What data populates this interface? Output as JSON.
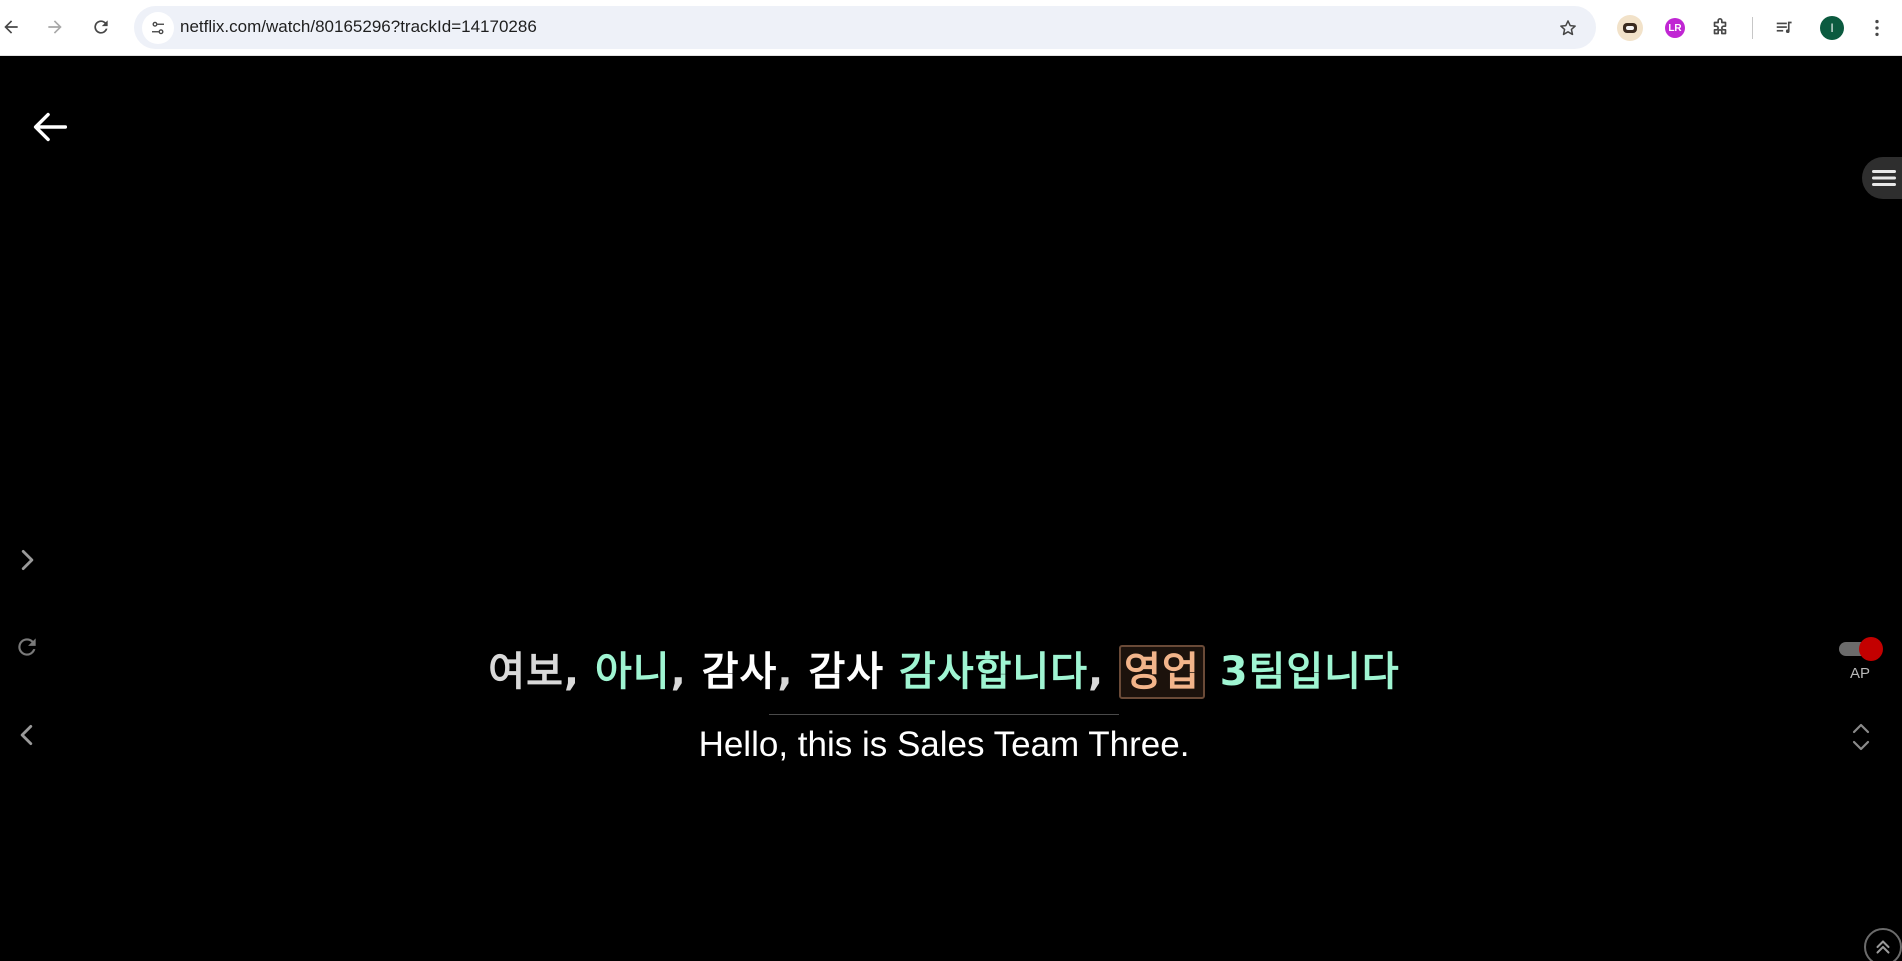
{
  "browser": {
    "url": "netflix.com/watch/80165296?trackId=14170286",
    "avatar_letter": "I",
    "extension_badge": "LR"
  },
  "icons": {
    "back": "arrow-left-icon",
    "forward": "arrow-right-icon",
    "reload": "reload-icon",
    "site_info": "tune-icon",
    "bookmark": "star-icon",
    "extensions": "puzzle-icon",
    "media": "media-queue-icon",
    "menu": "kebab-menu-icon",
    "player_back": "arrow-left-icon",
    "side_menu": "hamburger-icon",
    "next_line": "chevron-right-icon",
    "repeat_line": "replay-icon",
    "prev_line": "chevron-left-icon",
    "expand": "unfold-icon",
    "scroll_top": "double-chevron-up-icon"
  },
  "colors": {
    "background": "#000000",
    "subtitle_mint": "#9ff5d2",
    "subtitle_highlight": "#f2b48a",
    "toggle_on": "#c30000",
    "avatar": "#0b5a3f"
  },
  "subtitles": {
    "korean_tokens": [
      {
        "text": "여보",
        "style": "grey"
      },
      {
        "text": ", ",
        "style": "grey"
      },
      {
        "text": "아니",
        "style": "mint"
      },
      {
        "text": ", ",
        "style": "grey"
      },
      {
        "text": "감사",
        "style": "white"
      },
      {
        "text": ", ",
        "style": "grey"
      },
      {
        "text": "감사",
        "style": "white"
      },
      {
        "text": " ",
        "style": "white"
      },
      {
        "text": "감사합니다",
        "style": "mint"
      },
      {
        "text": ", ",
        "style": "grey"
      },
      {
        "text": "영업",
        "style": "highlight"
      },
      {
        "text": " ",
        "style": "white"
      },
      {
        "text": "3팀입니다",
        "style": "mint"
      }
    ],
    "english": "Hello, this is Sales Team Three."
  },
  "autopause": {
    "label": "AP",
    "enabled": true
  }
}
